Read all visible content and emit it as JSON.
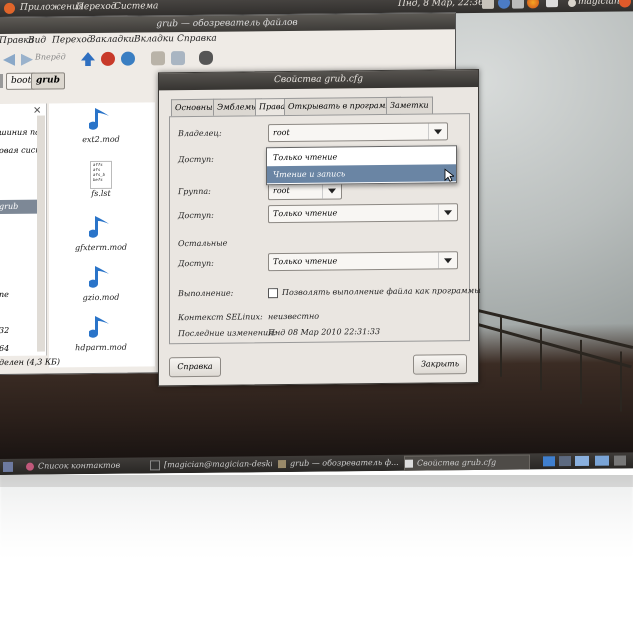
{
  "top_panel": {
    "menus": [
      "Приложения",
      "Переход",
      "Система"
    ],
    "clock": "Пнд, 8 Мар, 22:36",
    "user": "magician"
  },
  "file_manager": {
    "title": "grub — обозреватель файлов",
    "menubar": [
      "Правка",
      "Вид",
      "Переход",
      "Закладки",
      "Вкладки",
      "Справка"
    ],
    "forward_label": "Вперёд",
    "path": [
      "boot",
      "grub"
    ],
    "sidebar_items": [
      "шиния па",
      "овая сист",
      "",
      "",
      "grub",
      "",
      "",
      "",
      "",
      "ne",
      "",
      "32",
      "64"
    ],
    "files": [
      {
        "name": "ext2.mod",
        "icon": "audio-icon"
      },
      {
        "name": "fs.lst",
        "icon": "text-file-icon"
      },
      {
        "name": "gfxterm.mod",
        "icon": "audio-icon"
      },
      {
        "name": "gzio.mod",
        "icon": "audio-icon"
      },
      {
        "name": "hdparm.mod",
        "icon": "audio-icon"
      }
    ],
    "fs_lst_preview": [
      "affs",
      "afs",
      "afs_b",
      "befs"
    ],
    "status": "делен (4,3 КБ)"
  },
  "dialog": {
    "title": "Свойства grub.cfg",
    "tabs": [
      "Основные",
      "Эмблемы",
      "Права",
      "Открывать в программе",
      "Заметки"
    ],
    "active_tab": "Права",
    "owner_label": "Владелец:",
    "owner_value": "root",
    "access_label": "Доступ:",
    "access_options": [
      "Только чтение",
      "Чтение и запись"
    ],
    "selected_option": "Чтение и запись",
    "group_label": "Группа:",
    "group_value": "root",
    "group_access_label": "Доступ:",
    "group_access_value": "Только чтение",
    "others_label": "Остальные",
    "others_access_label": "Доступ:",
    "others_access_value": "Только чтение",
    "exec_label": "Выполнение:",
    "exec_checkbox": "Позволять выполнение файла как программы",
    "selinux_label": "Контекст SELinux:",
    "selinux_value": "неизвестно",
    "modified_label": "Последние изменения:",
    "modified_value": "Пнд 08 Мар 2010 22:31:33",
    "help_button": "Справка",
    "close_button": "Закрыть"
  },
  "taskbar": {
    "tasks": [
      {
        "label": "Список контактов",
        "icon": "contacts-icon"
      },
      {
        "label": "[magician@magician-deskt...",
        "icon": "terminal-icon"
      },
      {
        "label": "grub — обозреватель ф...",
        "icon": "folder-icon"
      },
      {
        "label": "Свойства grub.cfg",
        "icon": "properties-icon"
      }
    ]
  },
  "colors": {
    "panel_dark": "#302e2c",
    "selection": "#6a85a4",
    "music_icon": "#2a74c9"
  }
}
